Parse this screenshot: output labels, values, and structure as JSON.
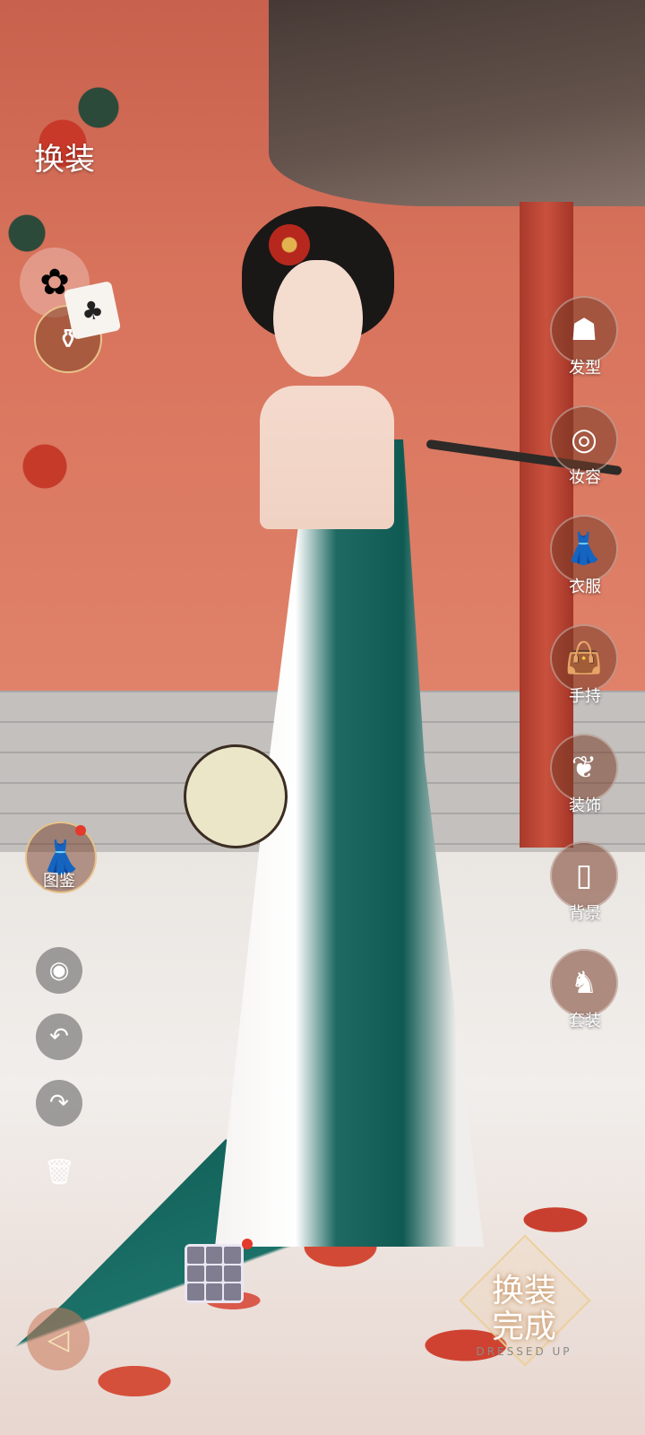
{
  "header": {
    "title": "换装"
  },
  "left_panel": {
    "pinwheel_icon": "pinwheel-icon",
    "bottle_icon": "bottle-icon",
    "card_icon": "playing-card-icon",
    "card_symbol": "♣",
    "catalog": {
      "label": "图鉴",
      "icon": "dress-icon",
      "has_notification": true
    },
    "tools": [
      {
        "name": "preview",
        "icon": "eye-icon",
        "glyph": "◉"
      },
      {
        "name": "undo",
        "icon": "undo-icon",
        "glyph": "↶"
      },
      {
        "name": "redo",
        "icon": "redo-icon",
        "glyph": "↷"
      },
      {
        "name": "delete",
        "icon": "trash-icon",
        "glyph": "🗑"
      }
    ]
  },
  "right_menu": {
    "items": [
      {
        "label": "发型",
        "icon": "hairstyle-icon",
        "glyph": "☗"
      },
      {
        "label": "妆容",
        "icon": "makeup-icon",
        "glyph": "◎"
      },
      {
        "label": "衣服",
        "icon": "dress-icon",
        "glyph": "👗"
      },
      {
        "label": "手持",
        "icon": "handheld-bag-icon",
        "glyph": "👜"
      },
      {
        "label": "装饰",
        "icon": "wings-icon",
        "glyph": "❦"
      },
      {
        "label": "背景",
        "icon": "background-card-icon",
        "glyph": "▯"
      },
      {
        "label": "套装",
        "icon": "outfit-set-icon",
        "glyph": "♞"
      }
    ]
  },
  "bottom": {
    "back_glyph": "◁",
    "thumbnails_has_notification": true,
    "done_button": {
      "line1": "换装",
      "line2": "完成",
      "subtitle": "DRESSED UP"
    }
  },
  "colors": {
    "wall": "#d8735c",
    "pillar": "#c9513d",
    "gown_teal": "#1f6a63",
    "notification": "#e43a2c",
    "gold": "#e8c38a"
  }
}
